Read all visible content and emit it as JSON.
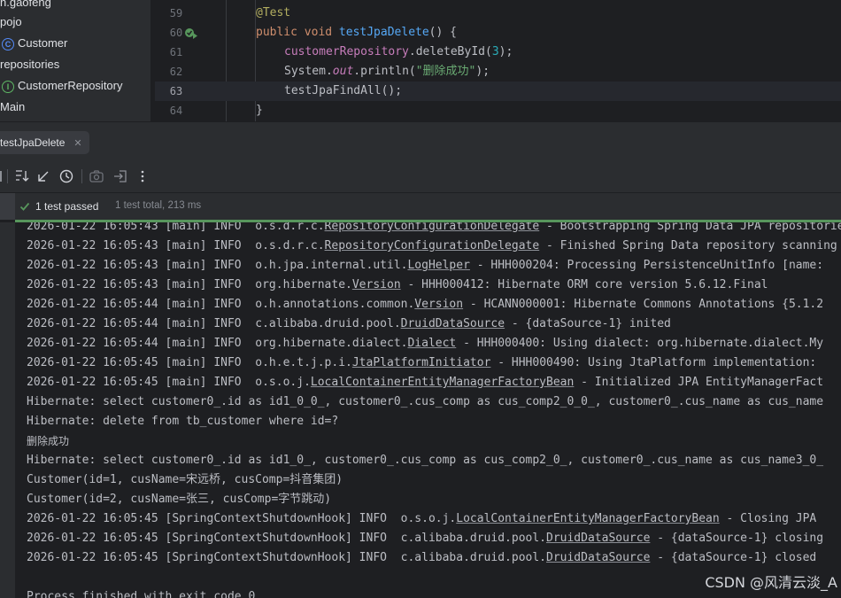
{
  "project_tree": {
    "items": [
      {
        "label": "n.gaofeng",
        "icon": "none"
      },
      {
        "label": "pojo",
        "icon": "none"
      },
      {
        "label": "Customer",
        "icon": "class-icon"
      },
      {
        "label": "repositories",
        "icon": "none"
      },
      {
        "label": "CustomerRepository",
        "icon": "interface-icon"
      },
      {
        "label": "Main",
        "icon": "none"
      }
    ]
  },
  "editor": {
    "lines": [
      {
        "num": "59",
        "code": "@Test"
      },
      {
        "num": "60",
        "kw": "public void ",
        "fn": "testJpaDelete",
        "rest": "() {"
      },
      {
        "num": "61",
        "field": "customerRepository",
        "mid": ".deleteById(",
        "number": "3",
        "end": ");"
      },
      {
        "num": "62",
        "pre": "System.",
        "ital": "out",
        "mid": ".println(",
        "string": "\"删除成功\"",
        "end": ");"
      },
      {
        "num": "63",
        "code": "testJpaFindAll();"
      },
      {
        "num": "64",
        "code": "}"
      }
    ]
  },
  "run": {
    "tab_label": "testJpaDelete",
    "status": "1 test passed",
    "total": "1 test total, 213 ms"
  },
  "console": {
    "lines": [
      {
        "prefix": "2026-01-22 16:05:43 [main] INFO  o.s.d.r.c.",
        "link": "RepositoryConfigurationDelegate",
        "suffix": " - Bootstrapping Spring Data JPA repositories"
      },
      {
        "prefix": "2026-01-22 16:05:43 [main] INFO  o.s.d.r.c.",
        "link": "RepositoryConfigurationDelegate",
        "suffix": " - Finished Spring Data repository scanning"
      },
      {
        "prefix": "2026-01-22 16:05:43 [main] INFO  o.h.jpa.internal.util.",
        "link": "LogHelper",
        "suffix": " - HHH000204: Processing PersistenceUnitInfo [name:"
      },
      {
        "prefix": "2026-01-22 16:05:43 [main] INFO  org.hibernate.",
        "link": "Version",
        "suffix": " - HHH000412: Hibernate ORM core version 5.6.12.Final"
      },
      {
        "prefix": "2026-01-22 16:05:44 [main] INFO  o.h.annotations.common.",
        "link": "Version",
        "suffix": " - HCANN000001: Hibernate Commons Annotations {5.1.2"
      },
      {
        "prefix": "2026-01-22 16:05:44 [main] INFO  c.alibaba.druid.pool.",
        "link": "DruidDataSource",
        "suffix": " - {dataSource-1} inited"
      },
      {
        "prefix": "2026-01-22 16:05:44 [main] INFO  org.hibernate.dialect.",
        "link": "Dialect",
        "suffix": " - HHH000400: Using dialect: org.hibernate.dialect.My"
      },
      {
        "prefix": "2026-01-22 16:05:45 [main] INFO  o.h.e.t.j.p.i.",
        "link": "JtaPlatformInitiator",
        "suffix": " - HHH000490: Using JtaPlatform implementation:"
      },
      {
        "prefix": "2026-01-22 16:05:45 [main] INFO  o.s.o.j.",
        "link": "LocalContainerEntityManagerFactoryBean",
        "suffix": " - Initialized JPA EntityManagerFact"
      },
      {
        "prefix": "Hibernate: select customer0_.id as id1_0_0_, customer0_.cus_comp as cus_comp2_0_0_, customer0_.cus_name as cus_name"
      },
      {
        "prefix": "Hibernate: delete from tb_customer where id=?"
      },
      {
        "prefix": "删除成功"
      },
      {
        "prefix": "Hibernate: select customer0_.id as id1_0_, customer0_.cus_comp as cus_comp2_0_, customer0_.cus_name as cus_name3_0_"
      },
      {
        "prefix": "Customer(id=1, cusName=宋远桥, cusComp=抖音集团)"
      },
      {
        "prefix": "Customer(id=2, cusName=张三, cusComp=字节跳动)"
      },
      {
        "prefix": "2026-01-22 16:05:45 [SpringContextShutdownHook] INFO  o.s.o.j.",
        "link": "LocalContainerEntityManagerFactoryBean",
        "suffix": " - Closing JPA"
      },
      {
        "prefix": "2026-01-22 16:05:45 [SpringContextShutdownHook] INFO  c.alibaba.druid.pool.",
        "link": "DruidDataSource",
        "suffix": " - {dataSource-1} closing"
      },
      {
        "prefix": "2026-01-22 16:05:45 [SpringContextShutdownHook] INFO  c.alibaba.druid.pool.",
        "link": "DruidDataSource",
        "suffix": " - {dataSource-1} closed"
      },
      {
        "prefix": ""
      },
      {
        "prefix": "Process finished with exit code 0"
      }
    ]
  },
  "watermark": "CSDN @风清云淡_A",
  "colors": {
    "pass_green": "#57965c",
    "keyword": "#cf8e6d",
    "annotation": "#b3ae60",
    "method": "#56a8f5",
    "string": "#6aab73",
    "field": "#c77dbb",
    "number": "#2aacb8"
  }
}
